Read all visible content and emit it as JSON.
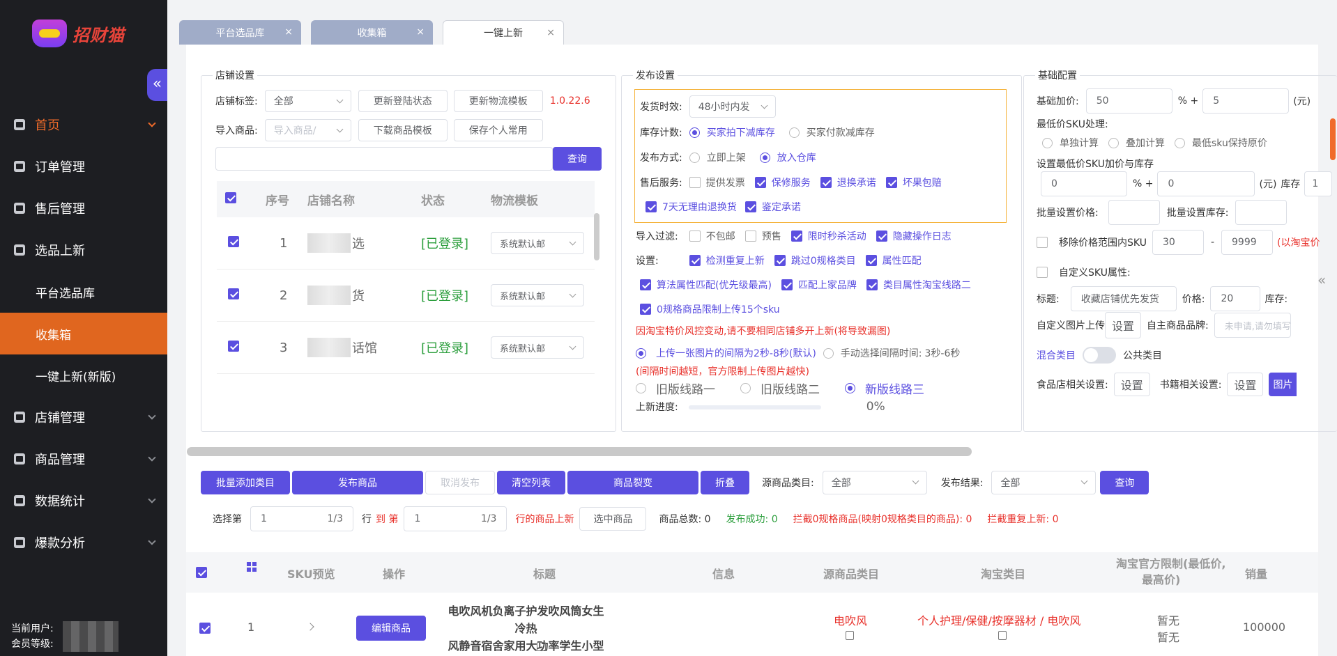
{
  "sidebar": {
    "logo_text": "招财猫",
    "menu": [
      {
        "label": "首页",
        "active": true
      },
      {
        "label": "订单管理"
      },
      {
        "label": "售后管理"
      },
      {
        "label": "选品上新"
      },
      {
        "label": "平台选品库",
        "sub": true
      },
      {
        "label": "收集箱",
        "sub": true,
        "selected": true
      },
      {
        "label": "一键上新(新版)",
        "sub": true
      },
      {
        "label": "店铺管理"
      },
      {
        "label": "商品管理"
      },
      {
        "label": "数据统计"
      },
      {
        "label": "爆款分析"
      }
    ],
    "current_user_label": "当前用户:",
    "member_level_label": "会员等级:"
  },
  "tabs": [
    {
      "label": "平台选品库"
    },
    {
      "label": "收集箱"
    },
    {
      "label": "一键上新",
      "active": true
    }
  ],
  "store_settings": {
    "legend": "店铺设置",
    "tag_label": "店铺标签:",
    "tag_value": "全部",
    "btn_refresh_login": "更新登陆状态",
    "btn_refresh_logistics": "更新物流模板",
    "version": "1.0.22.6",
    "import_label": "导入商品:",
    "import_placeholder": "导入商品/",
    "btn_download_template": "下载商品模板",
    "btn_save_personal": "保存个人常用",
    "query_button": "查询",
    "table_headers": [
      "序号",
      "店铺名称",
      "状态",
      "物流模板"
    ],
    "rows": [
      {
        "index": "1",
        "name_suffix": "选",
        "status": "[已登录]",
        "template": "系统默认邮"
      },
      {
        "index": "2",
        "name_suffix": "货",
        "status": "[已登录]",
        "template": "系统默认邮"
      },
      {
        "index": "3",
        "name_suffix": "话馆",
        "status": "[已登录]",
        "template": "系统默认邮"
      }
    ]
  },
  "publish_settings": {
    "legend": "发布设置",
    "ship_time_label": "发货时效:",
    "ship_time_value": "48小时内发",
    "stock_label": "库存计数:",
    "stock_opt1": "买家拍下减库存",
    "stock_opt2": "买家付款减库存",
    "method_label": "发布方式:",
    "method_opt1": "立即上架",
    "method_opt2": "放入仓库",
    "after_sale_label": "售后服务:",
    "after_sale_opts": [
      "提供发票",
      "保修服务",
      "退换承诺",
      "坏果包赔"
    ],
    "after_sale_opts2": [
      "7天无理由退换货",
      "鉴定承诺"
    ],
    "filter_label": "导入过滤:",
    "filter_opts": [
      "不包邮",
      "预售",
      "限时秒杀活动",
      "隐藏操作日志"
    ],
    "settings_label": "设置:",
    "settings_opts": [
      "检测重复上新",
      "跳过0规格类目",
      "属性匹配"
    ],
    "settings_opts2": [
      "算法属性匹配(优先级最高)",
      "匹配上家品牌",
      "类目属性淘宝线路二"
    ],
    "limit_opt": "0规格商品限制上传15个sku",
    "warning": "因淘宝特价风控变动,请不要相同店铺多开上新(将导致漏图)",
    "interval_opt1": "上传一张图片的间隔为2秒-8秒(默认)",
    "interval_opt2": "手动选择间隔时间:",
    "interval_value": "3秒-6秒",
    "interval_warning": "(间隔时间越短，官方限制上传图片越快)",
    "route1": "旧版线路一",
    "route2": "旧版线路二",
    "route3": "新版线路三",
    "progress_label": "上新进度:",
    "progress_value": "0%"
  },
  "base_config": {
    "legend": "基础配置",
    "markup_label": "基础加价:",
    "markup_value": "50",
    "percent_plus": "% +",
    "markup_add": "5",
    "unit_yuan": "(元)",
    "min_sku_label": "最低价SKU处理:",
    "min_sku_opts": [
      "单独计算",
      "叠加计算",
      "最低sku保持原价"
    ],
    "min_sku_set_label": "设置最低价SKU加价与库存",
    "min_sku_v1": "0",
    "min_sku_v2": "0",
    "stock_label": "库存",
    "stock_value": "1",
    "batch_price_label": "批量设置价格:",
    "batch_stock_label": "批量设置库存:",
    "remove_range_label": "移除价格范围内SKU",
    "range_min": "30",
    "range_dash": "-",
    "range_max": "9999",
    "range_note": "(以淘宝价",
    "custom_sku_label": "自定义SKU属性:",
    "title_label": "标题:",
    "title_value": "收藏店铺优先发货",
    "price_label": "价格:",
    "price_value": "20",
    "stock_label2": "库存:",
    "custom_img_label": "自定义图片上传",
    "set_button": "设置",
    "brand_label": "自主商品品牌:",
    "brand_placeholder": "未申请,请勿填写",
    "mixed_label": "混合类目",
    "public_label": "公共类目",
    "food_label": "食品店相关设置:",
    "book_label": "书籍相关设置:",
    "img_btn": "图片"
  },
  "actions": {
    "batch_add": "批量添加类目",
    "publish": "发布商品",
    "cancel_publish": "取消发布",
    "clear_list": "清空列表",
    "split": "商品裂变",
    "fold": "折叠",
    "source_cat_label": "源商品类目:",
    "source_cat_value": "全部",
    "result_label": "发布结果:",
    "result_value": "全部",
    "query": "查询"
  },
  "selection": {
    "select_label": "选择第",
    "from_value": "1",
    "from_page": "1/3",
    "row_label": "行",
    "to_label": "到 第",
    "to_value": "1",
    "to_page": "1/3",
    "rows_label": "行的商品上新",
    "selected_btn": "选中商品",
    "total": "商品总数: 0",
    "success": "发布成功: 0",
    "intercept_zero": "拦截0规格商品(映射0规格类目的商品): 0",
    "intercept_dup": "拦截重复上新: 0"
  },
  "products_table": {
    "headers": [
      "SKU预览",
      "操作",
      "标题",
      "信息",
      "源商品类目",
      "淘宝类目",
      "淘宝官方限制(最低价,",
      "最高价)",
      "销量"
    ],
    "rows": [
      {
        "index": "1",
        "edit_btn": "编辑商品",
        "title_line1": "电吹风机负离子护发吹风筒女生冷热",
        "title_line2": "风静音宿舍家用大功率学生小型",
        "source_cat": "电吹风",
        "taobao_cat": "个人护理/保健/按摩器材 / 电吹风",
        "limit1": "暂无",
        "limit2": "暂无",
        "sales": "100000"
      }
    ]
  },
  "colors": {
    "accent": "#5b4fe0",
    "sidebar_bg": "#1d1e22",
    "selected_menu": "#e0661f",
    "warning": "#e8302a",
    "success": "#2b9e3c"
  }
}
